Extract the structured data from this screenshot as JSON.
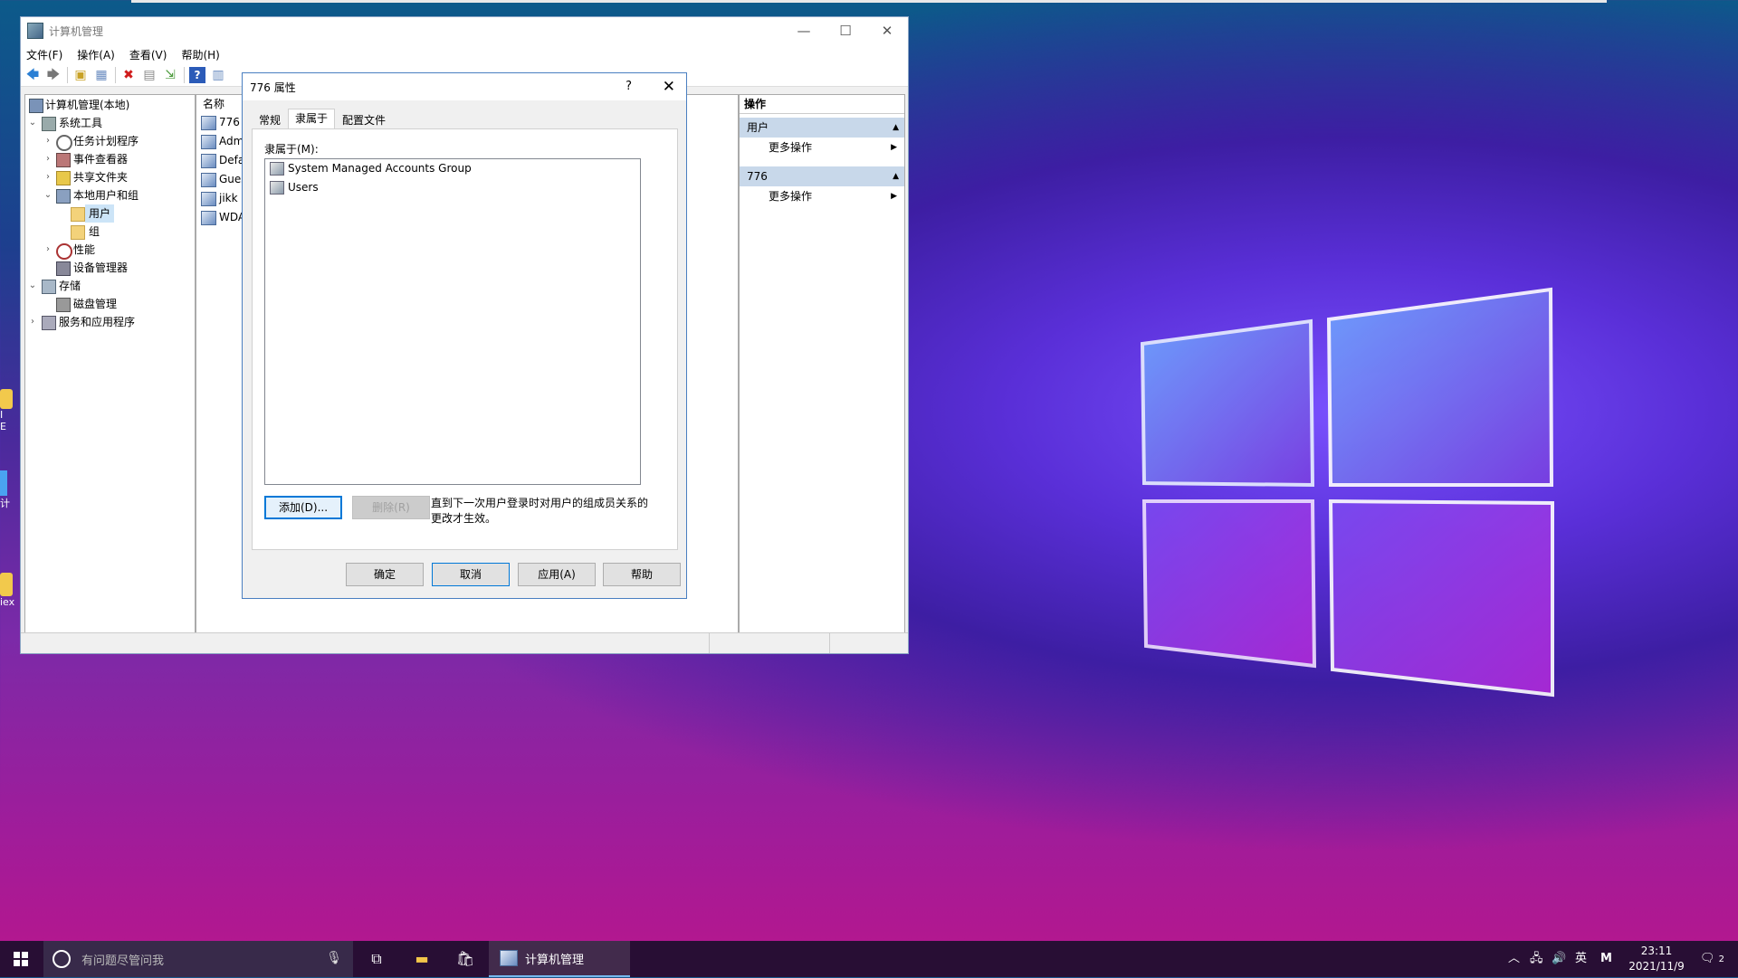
{
  "mmc": {
    "title": "计算机管理",
    "menu": [
      "文件(F)",
      "操作(A)",
      "查看(V)",
      "帮助(H)"
    ],
    "tree": [
      {
        "label": "计算机管理(本地)"
      },
      {
        "label": "系统工具"
      },
      {
        "label": "任务计划程序"
      },
      {
        "label": "事件查看器"
      },
      {
        "label": "共享文件夹"
      },
      {
        "label": "本地用户和组"
      },
      {
        "label": "用户"
      },
      {
        "label": "组"
      },
      {
        "label": "性能"
      },
      {
        "label": "设备管理器"
      },
      {
        "label": "存储"
      },
      {
        "label": "磁盘管理"
      },
      {
        "label": "服务和应用程序"
      }
    ],
    "list_header": "名称",
    "users": [
      "776",
      "Admi",
      "Defa",
      "Gues",
      "jikk",
      "WDA"
    ],
    "actions": {
      "header": "操作",
      "sections": [
        {
          "title": "用户",
          "item": "更多操作"
        },
        {
          "title": "776",
          "item": "更多操作"
        }
      ]
    }
  },
  "dialog": {
    "title": "776 属性",
    "help_glyph": "?",
    "tabs": [
      "常规",
      "隶属于",
      "配置文件"
    ],
    "member_of_label": "隶属于(M):",
    "groups": [
      "System Managed Accounts Group",
      "Users"
    ],
    "add_button": "添加(D)...",
    "remove_button": "删除(R)",
    "note": "直到下一次用户登录时对用户的组成员关系的更改才生效。",
    "ok": "确定",
    "cancel": "取消",
    "apply": "应用(A)",
    "help": "帮助"
  },
  "taskbar": {
    "search_placeholder": "有问题尽管问我",
    "active_app": "计算机管理",
    "ime_lang": "英",
    "ime_mode": "M",
    "time": "23:11",
    "date": "2021/11/9",
    "notification_count": "2"
  },
  "desktop": {
    "icon_fragments": [
      "I",
      "E",
      "计",
      "iex"
    ]
  }
}
